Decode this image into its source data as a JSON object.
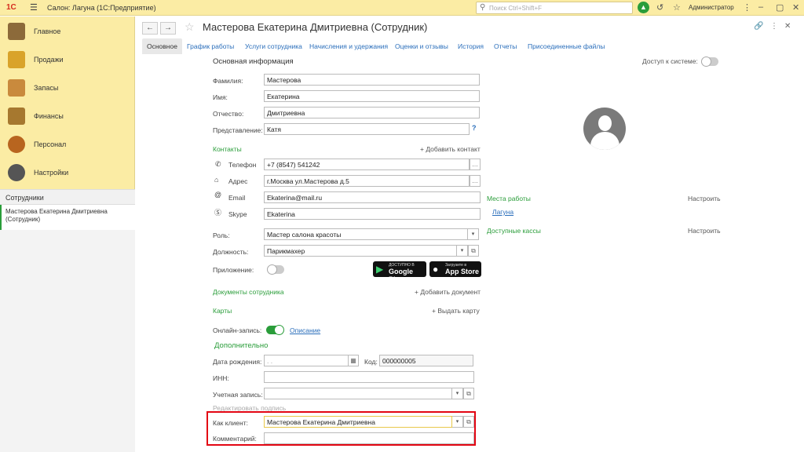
{
  "topbar": {
    "logo": "1С",
    "app_title": "Салон: Лагуна  (1С:Предприятие)",
    "search_placeholder": "Поиск Ctrl+Shift+F",
    "user": "Администратор"
  },
  "sidebar": {
    "items": [
      {
        "label": "Главное",
        "icon": "clipboard-icon"
      },
      {
        "label": "Продажи",
        "icon": "chart-icon"
      },
      {
        "label": "Запасы",
        "icon": "boxes-icon"
      },
      {
        "label": "Финансы",
        "icon": "wallet-icon"
      },
      {
        "label": "Персонал",
        "icon": "people-icon"
      },
      {
        "label": "Настройки",
        "icon": "gear-icon"
      }
    ],
    "section": "Сотрудники",
    "open_window": "Мастерова Екатерина Дмитриевна (Сотрудник)"
  },
  "window": {
    "title": "Мастерова Екатерина Дмитриевна (Сотрудник)",
    "tabs": [
      "Основное",
      "График работы",
      "Услуги сотрудника",
      "Начисления и удержания",
      "Оценки и отзывы",
      "История",
      "Отчеты",
      "Присоединенные файлы"
    ]
  },
  "form": {
    "section_main": "Основная информация",
    "system_access": "Доступ к системе:",
    "last_name_label": "Фамилия:",
    "last_name": "Мастерова",
    "first_name_label": "Имя:",
    "first_name": "Екатерина",
    "patronymic_label": "Отчество:",
    "patronymic": "Дмитриевна",
    "display_label": "Представление:",
    "display": "Катя",
    "help": "?",
    "contacts_label": "Контакты",
    "add_contact": "+ Добавить контакт",
    "phone_label": "Телефон",
    "phone": "+7 (8547) 541242",
    "address_label": "Адрес",
    "address": "г.Москва ул.Мастерова д.5",
    "email_label": "Email",
    "email": "Ekaterina@mail.ru",
    "skype_label": "Skype",
    "skype": "Ekaterina",
    "role_label": "Роль:",
    "role": "Мастер салона красоты",
    "position_label": "Должность:",
    "position": "Парикмахер",
    "app_label": "Приложение:",
    "app_enabled": false,
    "google_small": "ДОСТУПНО В",
    "google_big": "Google Play",
    "apple_small": "Загрузите в",
    "apple_big": "App Store",
    "docs_label": "Документы сотрудника",
    "add_doc": "+ Добавить документ",
    "cards_label": "Карты",
    "issue_card": "+ Выдать карту",
    "online_label": "Онлайн-запись:",
    "online_enabled": true,
    "description_link": "Описание",
    "additional_label": "Дополнительно",
    "birth_label": "Дата рождения:",
    "birth_placeholder": ". .",
    "code_label": "Код:",
    "code": "000000005",
    "inn_label": "ИНН:",
    "account_label": "Учетная запись:",
    "edit_caption": "Редактировать подпись",
    "client_label": "Как клиент:",
    "client": "Мастерова Екатерина Дмитриевна",
    "comment_label": "Комментарий:",
    "comment": ""
  },
  "right_panel": {
    "workplaces_label": "Места работы",
    "workplaces_config": "Настроить",
    "workplace": "Лагуна",
    "cash_label": "Доступные кассы",
    "cash_config": "Настроить"
  },
  "colors": {
    "topbar_bg": "#fbeca4",
    "accent_green": "#2a9d3a",
    "link_blue": "#2a6ebb",
    "highlight_red": "#e30613"
  }
}
